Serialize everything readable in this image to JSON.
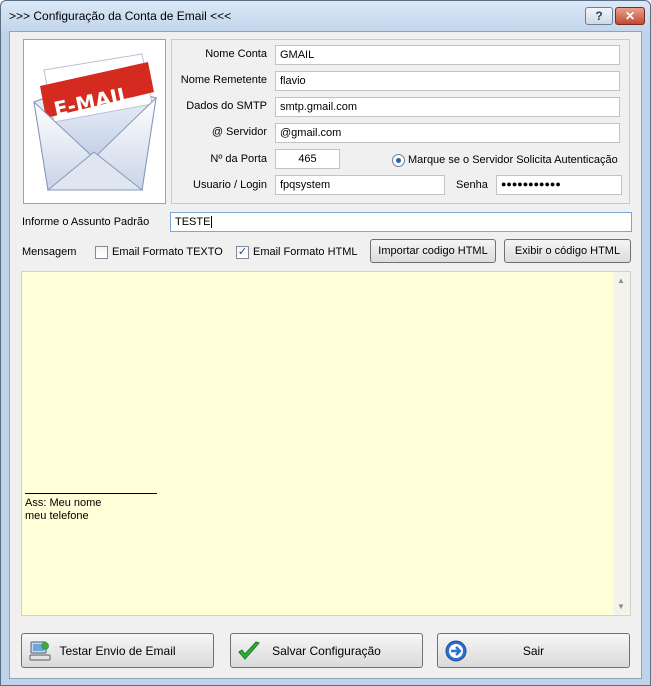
{
  "window": {
    "title": ">>> Configuração da Conta de Email <<<",
    "help_label": "?",
    "close_label": "✕"
  },
  "logo": {
    "text": "E-MAIL"
  },
  "account": {
    "nome_conta_label": "Nome Conta",
    "nome_conta_value": "GMAIL",
    "nome_remetente_label": "Nome Remetente",
    "nome_remetente_value": "flavio",
    "smtp_label": "Dados do SMTP",
    "smtp_value": "smtp.gmail.com",
    "servidor_label": "@ Servidor",
    "servidor_value": "@gmail.com",
    "porta_label": "Nº da Porta",
    "porta_value": "465",
    "auth_label": "Marque se o Servidor Solicita Autenticação",
    "auth_checked": true,
    "usuario_label": "Usuario / Login",
    "usuario_value": "fpqsystem",
    "senha_label": "Senha",
    "senha_value": "●●●●●●●●●●●"
  },
  "subject": {
    "label": "Informe o Assunto Padrão",
    "value": "TESTE"
  },
  "message": {
    "label": "Mensagem",
    "texto_label": "Email Formato TEXTO",
    "texto_checked": false,
    "html_label": "Email Formato HTML",
    "html_checked": true,
    "import_button": "Importar codigo HTML",
    "show_button": "Exibir o código HTML"
  },
  "editor": {
    "signature_line1": "Ass: Meu  nome",
    "signature_line2": "meu telefone"
  },
  "actions": {
    "test_button": "Testar Envio de Email",
    "save_button": "Salvar Configuração",
    "exit_button": "Sair"
  },
  "colors": {
    "editor_bg": "#ffffd8",
    "accent": "#2d61a8",
    "logo_red": "#d42a1f"
  }
}
